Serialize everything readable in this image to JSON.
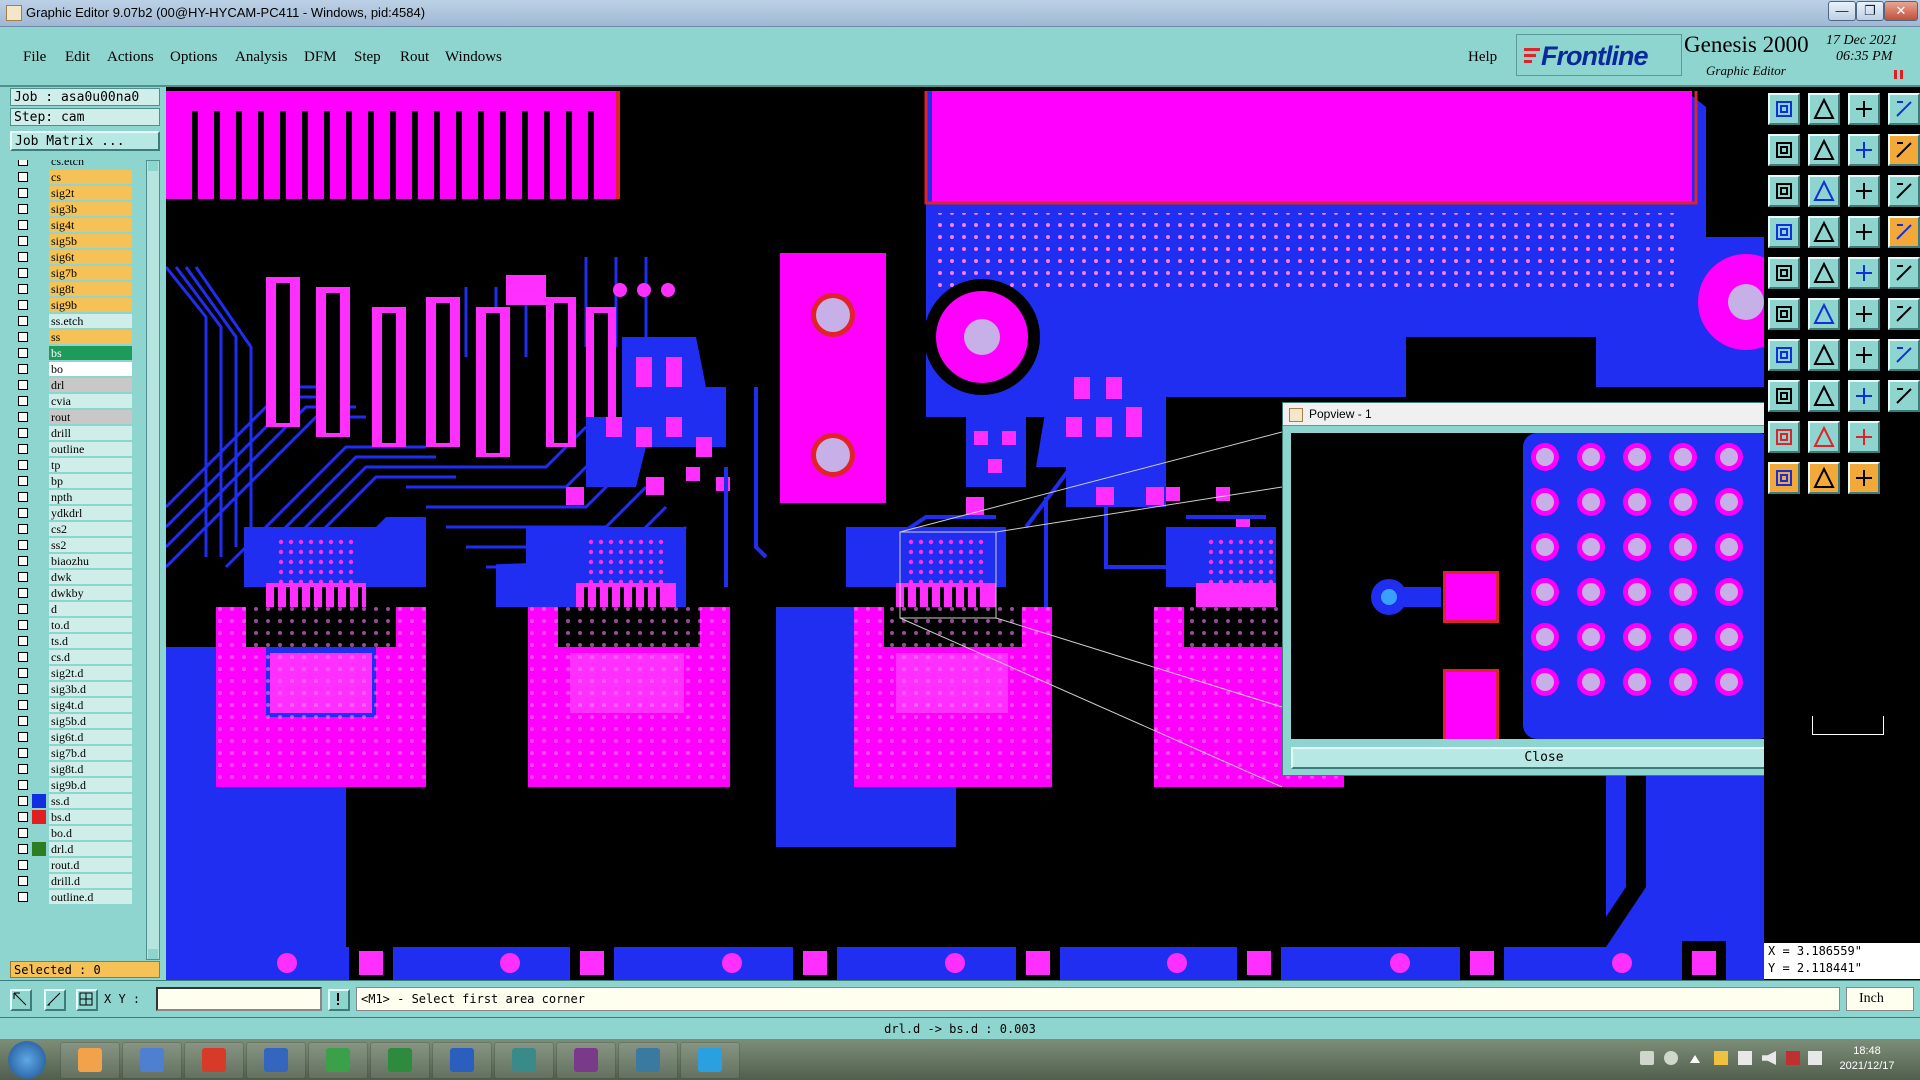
{
  "window": {
    "title": "Graphic Editor 9.07b2 (00@HY-HYCAM-PC411 - Windows, pid:4584)",
    "buttons": [
      "—",
      "❐",
      "✕"
    ]
  },
  "menu": {
    "items": [
      "File",
      "Edit",
      "Actions",
      "Options",
      "Analysis",
      "DFM",
      "Step",
      "Rout",
      "Windows"
    ],
    "help": "Help"
  },
  "brand": {
    "logo": "Frontline",
    "product": "Genesis 2000",
    "subtitle": "Graphic Editor",
    "date": "17 Dec 2021",
    "time": "06:35 PM"
  },
  "job": {
    "job_line": "Job : asa0u00na0",
    "step_line": "Step: cam",
    "matrix_button": "Job Matrix ..."
  },
  "layers": [
    {
      "name": "cs.etch",
      "color": "#8fd5cf",
      "swatch": ""
    },
    {
      "name": "cs",
      "color": "#f6c257",
      "swatch": ""
    },
    {
      "name": "sig2t",
      "color": "#f6c257",
      "swatch": ""
    },
    {
      "name": "sig3b",
      "color": "#f6c257",
      "swatch": ""
    },
    {
      "name": "sig4t",
      "color": "#f6c257",
      "swatch": ""
    },
    {
      "name": "sig5b",
      "color": "#f6c257",
      "swatch": ""
    },
    {
      "name": "sig6t",
      "color": "#f6c257",
      "swatch": ""
    },
    {
      "name": "sig7b",
      "color": "#f6c257",
      "swatch": ""
    },
    {
      "name": "sig8t",
      "color": "#f6c257",
      "swatch": ""
    },
    {
      "name": "sig9b",
      "color": "#f6c257",
      "swatch": ""
    },
    {
      "name": "ss.etch",
      "color": "#cfeeea",
      "swatch": ""
    },
    {
      "name": "ss",
      "color": "#f6c257",
      "swatch": ""
    },
    {
      "name": "bs",
      "color": "#1e9a5a",
      "swatch": ""
    },
    {
      "name": "bo",
      "color": "#ffffff",
      "swatch": ""
    },
    {
      "name": "drl",
      "color": "#c8c8c8",
      "swatch": ""
    },
    {
      "name": "cvia",
      "color": "#cfeeea",
      "swatch": ""
    },
    {
      "name": "rout",
      "color": "#c8c8c8",
      "swatch": ""
    },
    {
      "name": "drill",
      "color": "#cfeeea",
      "swatch": ""
    },
    {
      "name": "outline",
      "color": "#cfeeea",
      "swatch": ""
    },
    {
      "name": "tp",
      "color": "#cfeeea",
      "swatch": ""
    },
    {
      "name": "bp",
      "color": "#cfeeea",
      "swatch": ""
    },
    {
      "name": "npth",
      "color": "#cfeeea",
      "swatch": ""
    },
    {
      "name": "ydkdrl",
      "color": "#cfeeea",
      "swatch": ""
    },
    {
      "name": "cs2",
      "color": "#cfeeea",
      "swatch": ""
    },
    {
      "name": "ss2",
      "color": "#cfeeea",
      "swatch": ""
    },
    {
      "name": "biaozhu",
      "color": "#cfeeea",
      "swatch": ""
    },
    {
      "name": "dwk",
      "color": "#cfeeea",
      "swatch": ""
    },
    {
      "name": "dwkby",
      "color": "#cfeeea",
      "swatch": ""
    },
    {
      "name": "d",
      "color": "#cfeeea",
      "swatch": ""
    },
    {
      "name": "to.d",
      "color": "#cfeeea",
      "swatch": ""
    },
    {
      "name": "ts.d",
      "color": "#cfeeea",
      "swatch": ""
    },
    {
      "name": "cs.d",
      "color": "#cfeeea",
      "swatch": ""
    },
    {
      "name": "sig2t.d",
      "color": "#cfeeea",
      "swatch": ""
    },
    {
      "name": "sig3b.d",
      "color": "#cfeeea",
      "swatch": ""
    },
    {
      "name": "sig4t.d",
      "color": "#cfeeea",
      "swatch": ""
    },
    {
      "name": "sig5b.d",
      "color": "#cfeeea",
      "swatch": ""
    },
    {
      "name": "sig6t.d",
      "color": "#cfeeea",
      "swatch": ""
    },
    {
      "name": "sig7b.d",
      "color": "#cfeeea",
      "swatch": ""
    },
    {
      "name": "sig8t.d",
      "color": "#cfeeea",
      "swatch": ""
    },
    {
      "name": "sig9b.d",
      "color": "#cfeeea",
      "swatch": ""
    },
    {
      "name": "ss.d",
      "color": "#cfeeea",
      "swatch": "#1030e0"
    },
    {
      "name": "bs.d",
      "color": "#cfeeea",
      "swatch": "#e02020"
    },
    {
      "name": "bo.d",
      "color": "#cfeeea",
      "swatch": ""
    },
    {
      "name": "drl.d",
      "color": "#cfeeea",
      "swatch": "#2e7d20"
    },
    {
      "name": "rout.d",
      "color": "#cfeeea",
      "swatch": ""
    },
    {
      "name": "drill.d",
      "color": "#cfeeea",
      "swatch": ""
    },
    {
      "name": "outline.d",
      "color": "#cfeeea",
      "swatch": ""
    }
  ],
  "selected": "Selected : 0",
  "coords": {
    "x": "X = 3.186559\"",
    "y": "Y = 2.118441\""
  },
  "popview": {
    "title": "Popview - 1",
    "close": "Close"
  },
  "bottom": {
    "xy_label": "X Y :",
    "xy_value": "",
    "prompt": "<M1> - Select first area corner",
    "unit": "Inch",
    "status": "drl.d -> bs.d : 0.003"
  },
  "clock": {
    "time": "18:48",
    "date": "2021/12/17"
  },
  "colors": {
    "copper_pink": "#ff00ff",
    "plane_blue": "#1f2ef0",
    "panel": "#8fd5cf",
    "accent_orange": "#f6c257"
  },
  "icons": {
    "taskbar": [
      "windows-start-icon",
      "shell-icon",
      "notepad-icon",
      "acrobat-icon",
      "save-icon",
      "project-icon",
      "excel-icon",
      "word-icon",
      "eye-viewer-icon",
      "x-app-icon",
      "camera-icon",
      "telegram-icon"
    ]
  }
}
